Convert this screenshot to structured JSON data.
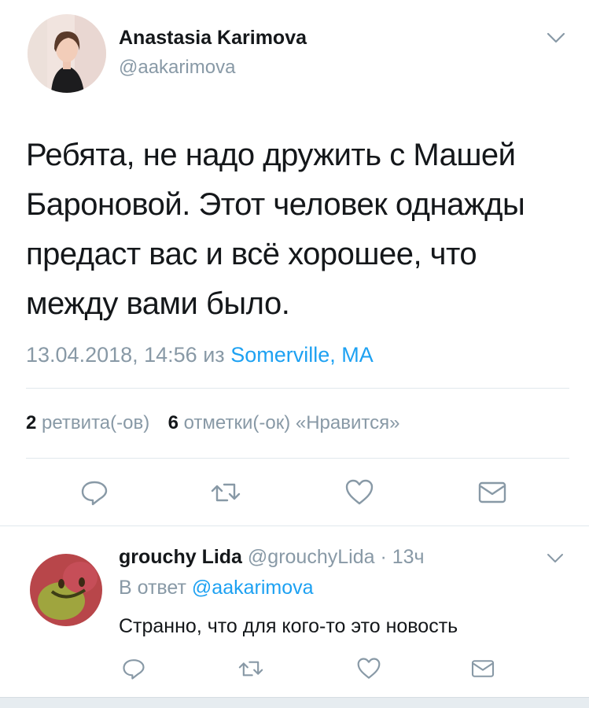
{
  "tweet": {
    "author_name": "Anastasia Karimova",
    "author_handle": "@aakarimova",
    "text_lines": [
      "Ребята, не надо дружить с Машей",
      "Бароновой. Этот человек однажды",
      "предаст вас и всё хорошее, что",
      "между вами было."
    ],
    "timestamp": "13.04.2018, 14:56",
    "via": "из",
    "location": "Somerville, MA",
    "retweets_count": "2",
    "retweets_label": "ретвита(-ов)",
    "likes_count": "6",
    "likes_label": "отметки(-ок) «Нравится»"
  },
  "reply": {
    "author_name": "grouchy Lida",
    "author_handle": "@grouchyLida",
    "separator": "·",
    "age": "13ч",
    "reply_to_label": "В ответ",
    "reply_to_handle": "@aakarimova",
    "text": "Странно, что для кого-то это новость"
  },
  "icons": {
    "reply": "reply-icon",
    "retweet": "retweet-icon",
    "like": "heart-icon",
    "message": "envelope-icon",
    "more": "chevron-down-icon"
  },
  "colors": {
    "accent": "#1da1f2",
    "secondary_text": "#8899a6",
    "divider": "#e1e8ed"
  }
}
